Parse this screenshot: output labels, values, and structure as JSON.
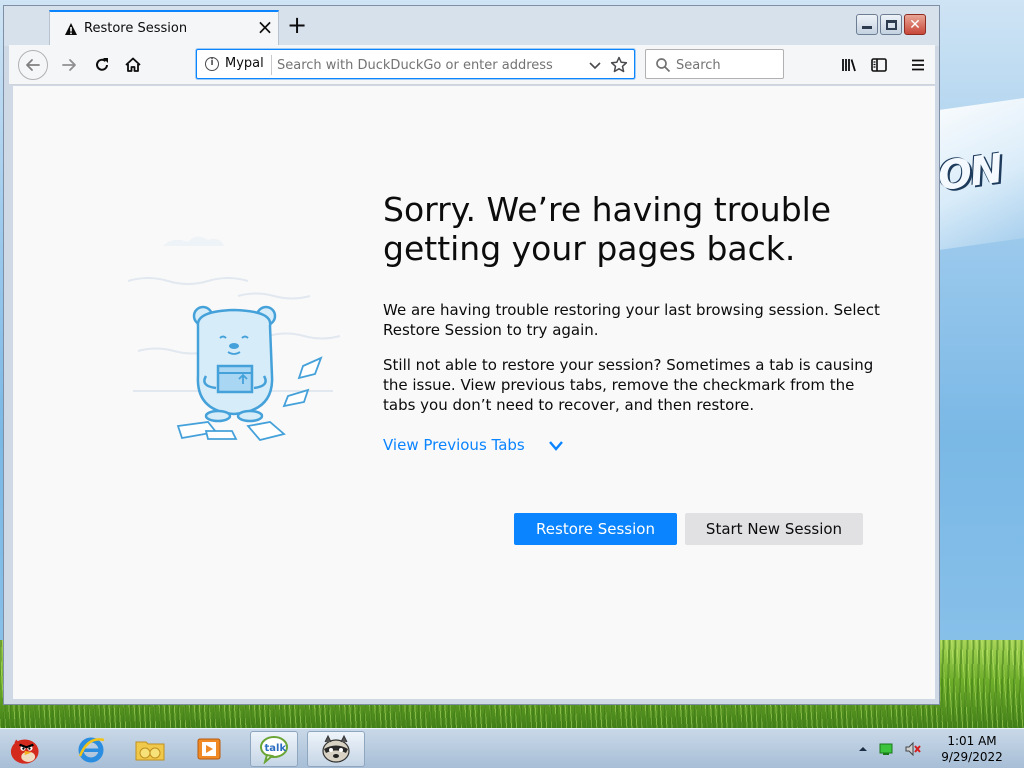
{
  "window": {
    "tab_title": "Restore Session",
    "new_tab_label": "+",
    "close_tab_label": "×"
  },
  "toolbar": {
    "identity_label": "Mypal",
    "url_placeholder": "Search with DuckDuckGo or enter address",
    "search_placeholder": "Search"
  },
  "page": {
    "heading": "Sorry. We’re having trouble getting your pages back.",
    "paragraph1": "We are having trouble restoring your last browsing session. Select Restore Session to try again.",
    "paragraph2": "Still not able to restore your session? Sometimes a tab is causing the issue. View previous tabs, remove the checkmark from the tabs you don’t need to recover, and then restore.",
    "view_previous_tabs": "View Previous Tabs",
    "restore_button": "Restore Session",
    "new_session_button": "Start New Session"
  },
  "taskbar": {
    "items": [
      "angry-birds",
      "internet-explorer",
      "folders",
      "media-player",
      "google-talk",
      "mypal"
    ],
    "clock_time": "1:01 AM",
    "clock_date": "9/29/2022"
  },
  "colors": {
    "accent": "#0a84ff",
    "page_bg": "#f9f9fa",
    "illustration": "#45a1d9"
  }
}
